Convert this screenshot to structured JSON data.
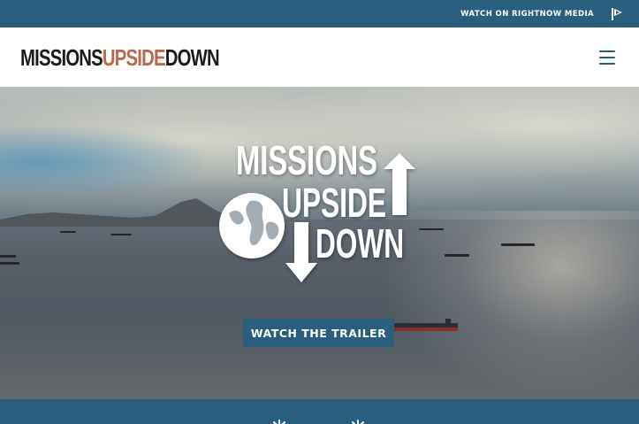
{
  "topbar": {
    "watch_link": "WATCH ON RIGHTNOW MEDIA",
    "flag_icon": "rightnow-flag-icon"
  },
  "header": {
    "logo": {
      "word1": "MISSIONS",
      "word2": "UPSIDE",
      "word3": "DOWN"
    },
    "menu_icon": "hamburger-icon"
  },
  "hero": {
    "logo": {
      "line1": "MISSIONS",
      "line2": "UPSIDE",
      "line3": "DOWN"
    },
    "trailer_button": "WATCH THE TRAILER"
  },
  "colors": {
    "brand_blue": "#2a5e7e",
    "accent_terracotta": "#b96a4b",
    "dark_text": "#1b1b1b"
  }
}
